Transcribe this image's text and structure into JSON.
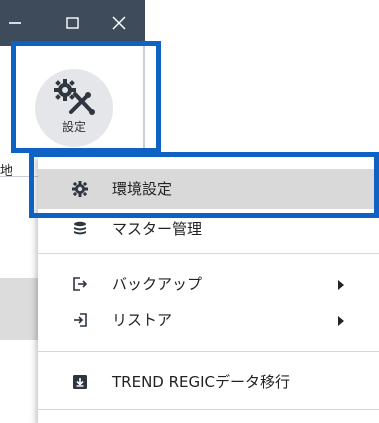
{
  "window": {
    "minimize_icon": "minimize-icon",
    "maximize_icon": "maximize-icon",
    "close_icon": "close-icon",
    "titlebar_color": "#3e4b5b"
  },
  "ribbon": {
    "settings_label": "設定",
    "settings_icon": "gear-and-tools-icon",
    "left_clipped_text": "地理"
  },
  "highlight_color": "#0d62c4",
  "menu": {
    "items": [
      {
        "label": "環境設定",
        "icon": "gear-icon",
        "selected": true,
        "submenu": false
      },
      {
        "label": "マスター管理",
        "icon": "database-icon",
        "selected": false,
        "submenu": false
      },
      {
        "label": "バックアップ",
        "icon": "export-icon",
        "selected": false,
        "submenu": true
      },
      {
        "label": "リストア",
        "icon": "import-icon",
        "selected": false,
        "submenu": true
      },
      {
        "label": "TREND REGICデータ移行",
        "icon": "migrate-icon",
        "selected": false,
        "submenu": false
      }
    ]
  }
}
